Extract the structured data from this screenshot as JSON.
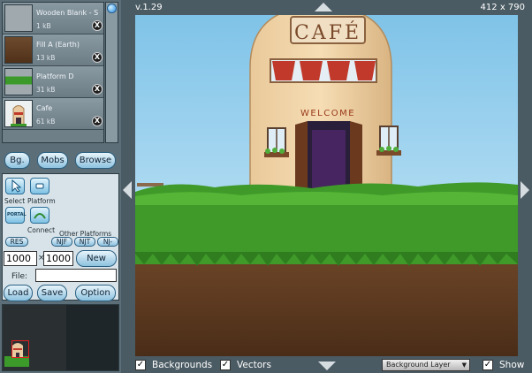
{
  "assets": [
    {
      "name": "Wooden Blank - S",
      "size": "1 kB"
    },
    {
      "name": "Fill A (Earth)",
      "size": "13 kB"
    },
    {
      "name": "Platform D",
      "size": "31 kB"
    },
    {
      "name": "Cafe",
      "size": "61 kB"
    }
  ],
  "delete_label": "X",
  "tabs": {
    "bg": "Bg.",
    "mobs": "Mobs",
    "browse": "Browse"
  },
  "tools": {
    "select": "Select",
    "platform": "Platform",
    "connect": "Connect",
    "portal": "PORTAL",
    "other_platforms": "Other Platforms",
    "res": "RES",
    "njf": "NJF",
    "njt": "NJT",
    "nj": "NJ-"
  },
  "size": {
    "width": "1000",
    "times": "×",
    "height": "1000",
    "new": "New"
  },
  "file": {
    "label": "File:",
    "value": ""
  },
  "actions": {
    "load": "Load",
    "save": "Save",
    "option": "Option"
  },
  "viewport": {
    "version": "v.1.29",
    "dimensions": "412 x 790"
  },
  "scene": {
    "sign": "CAFÉ",
    "welcome": "WELCOME"
  },
  "bottom": {
    "backgrounds": "Backgrounds",
    "vectors": "Vectors",
    "layer": "Background Layer",
    "show": "Show",
    "check": "✓"
  },
  "colors": {
    "panel": "#5c6e78",
    "button": "#8dc2df",
    "grass": "#3f9a2a",
    "soil": "#5a3a22",
    "sky": "#a9d8f0"
  }
}
